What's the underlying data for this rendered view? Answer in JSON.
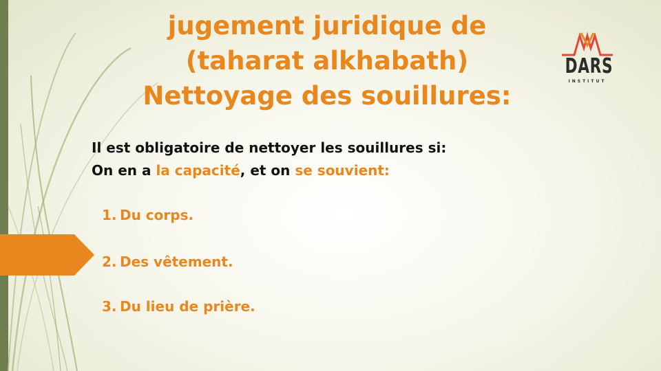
{
  "title": {
    "line1": "jugement juridique de",
    "line2": "(taharat alkhabath)",
    "line3": "Nettoyage des souillures:"
  },
  "logo": {
    "wordmark": "DARS",
    "subtitle": "INSTITUT"
  },
  "intro": {
    "line1": "Il est obligatoire de nettoyer les souillures si:",
    "line2_a": "On en a ",
    "line2_b": "la capacité",
    "line2_c": ", et on ",
    "line2_d": "se souvient:"
  },
  "list": [
    {
      "num": "1.",
      "text": "Du corps."
    },
    {
      "num": "2.",
      "text": "Des vêtement."
    },
    {
      "num": "3.",
      "text": "Du lieu de prière."
    }
  ],
  "colors": {
    "accent": "#e8871e",
    "bar": "#6e7e50",
    "text": "#111111"
  }
}
